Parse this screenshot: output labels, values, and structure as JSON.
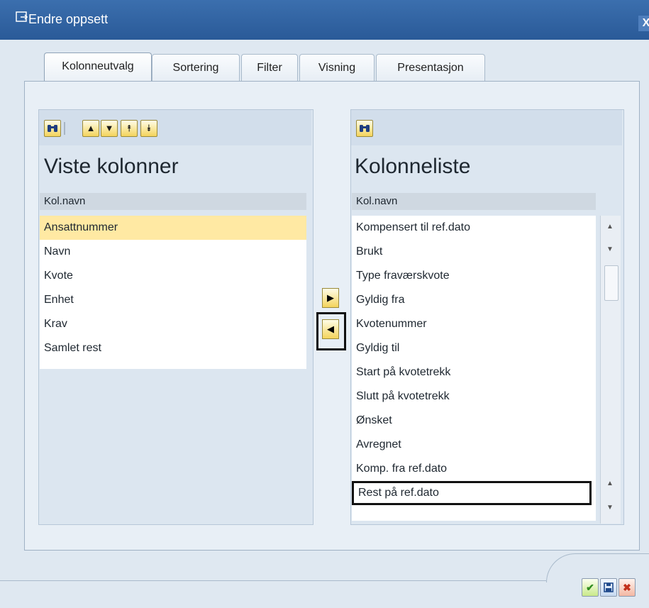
{
  "window": {
    "title": "Endre oppsett",
    "close_label": "X"
  },
  "tabs": [
    {
      "label": "Kolonneutvalg",
      "active": true
    },
    {
      "label": "Sortering",
      "active": false
    },
    {
      "label": "Filter",
      "active": false
    },
    {
      "label": "Visning",
      "active": false
    },
    {
      "label": "Presentasjon",
      "active": false
    }
  ],
  "left": {
    "title": "Viste kolonner",
    "header": "Kol.navn",
    "rows": [
      "Ansattnummer",
      "Navn",
      "Kvote",
      "Enhet",
      "Krav",
      "Samlet rest"
    ],
    "selected_index": 0,
    "toolbar": [
      "binoculars-icon",
      "arrow-up-icon",
      "arrow-down-icon",
      "arrow-top-icon",
      "arrow-bottom-icon"
    ]
  },
  "right": {
    "title": "Kolonneliste",
    "header": "Kol.navn",
    "rows": [
      "Kompensert til ref.dato",
      "Brukt",
      "Type fraværskvote",
      "Gyldig fra",
      "Kvotenummer",
      "Gyldig til",
      "Start på kvotetrekk",
      "Slutt på kvotetrekk",
      "Ønsket",
      "Avregnet",
      "Komp. fra ref.dato",
      "Rest på ref.dato"
    ],
    "highlighted_row": "Rest på ref.dato",
    "toolbar": [
      "binoculars-icon"
    ]
  },
  "transfer": {
    "add_icon": "arrow-right-icon",
    "remove_icon": "arrow-left-icon"
  },
  "footer": {
    "buttons": [
      "confirm-icon",
      "save-icon",
      "cancel-icon"
    ]
  },
  "colors": {
    "titlebar": "#2a5a98",
    "selected_row": "#ffe9a3",
    "accent_button": "#f4d45c"
  }
}
